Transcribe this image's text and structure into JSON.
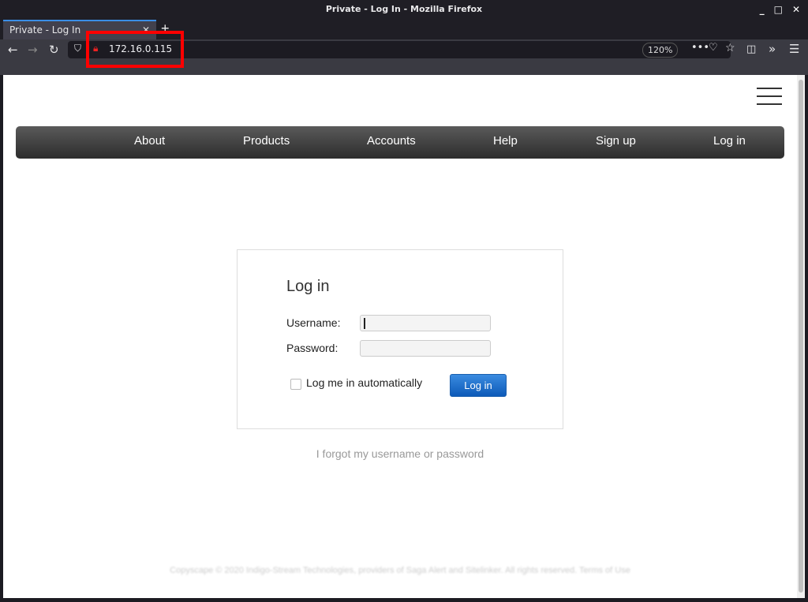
{
  "window": {
    "title": "Private - Log In - Mozilla Firefox"
  },
  "tab": {
    "label": "Private - Log In"
  },
  "browser": {
    "url": "172.16.0.115",
    "zoom": "120%"
  },
  "nav": [
    "About",
    "Products",
    "Accounts",
    "Help",
    "Sign up",
    "Log in"
  ],
  "login": {
    "title": "Log in",
    "username_label": "Username:",
    "password_label": "Password:",
    "username_value": "",
    "password_value": "",
    "remember_label": "Log me in automatically",
    "remember_checked": false,
    "submit": "Log in",
    "forgot": "I forgot my username or password"
  },
  "footer": "Copyscape © 2020 Indigo-Stream Technologies, providers of Saga Alert and Sitelinker. All rights reserved. Terms of Use",
  "colors": {
    "highlight": "#ff0000",
    "button": "#1e6fcf"
  }
}
